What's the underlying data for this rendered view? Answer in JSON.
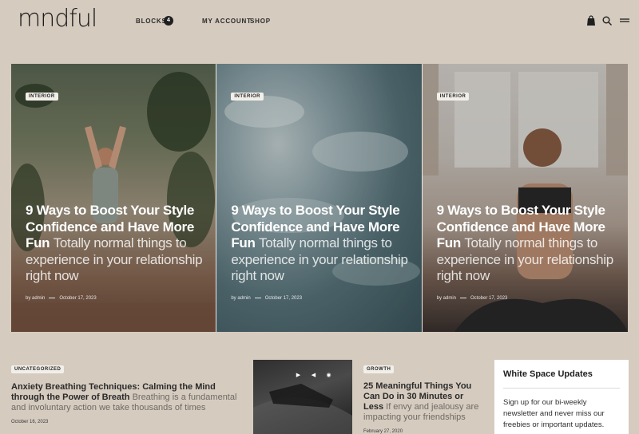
{
  "header": {
    "logo": "mndful",
    "nav": {
      "blocks": "BLOCKS",
      "blocks_badge": "4",
      "account": "MY ACCOUNT",
      "shop": "SHOP"
    },
    "icons": [
      "bag-icon",
      "search-icon",
      "menu-icon"
    ]
  },
  "hero_cards": [
    {
      "tag": "INTERIOR",
      "title": "9 Ways to Boost Your Style Confidence and Have More Fun",
      "excerpt": "Totally normal things to experience in your relationship right now",
      "author": "by admin",
      "date": "October 17, 2023"
    },
    {
      "tag": "INTERIOR",
      "title": "9 Ways to Boost Your Style Confidence and Have More Fun",
      "excerpt": "Totally normal things to experience in your relationship right now",
      "author": "by admin",
      "date": "October 17, 2023"
    },
    {
      "tag": "INTERIOR",
      "title": "9 Ways to Boost Your Style Confidence and Have More Fun",
      "excerpt": "Totally normal things to experience in your relationship right now",
      "author": "by admin",
      "date": "October 17, 2023"
    }
  ],
  "post_uncategorized": {
    "tag": "UNCATEGORIZED",
    "title": "Anxiety Breathing Techniques: Calming the Mind through the Power of Breath",
    "excerpt": "Breathing is a fundamental and involuntary action we take thousands of times",
    "date": "October 16, 2023"
  },
  "post_growth": {
    "tag": "GROWTH",
    "title": "25 Meaningful Things You Can Do in 30 Minutes or Less",
    "excerpt": "If envy and jealousy are impacting your friendships",
    "date": "February 27, 2020"
  },
  "sidebar": {
    "title": "White Space Updates",
    "text": "Sign up for our bi-weekly newsletter and never miss our freebies or important updates."
  },
  "colors": {
    "background": "#d5cbbf",
    "text": "#1f1f1f",
    "sidebar_bg": "#ffffff"
  }
}
